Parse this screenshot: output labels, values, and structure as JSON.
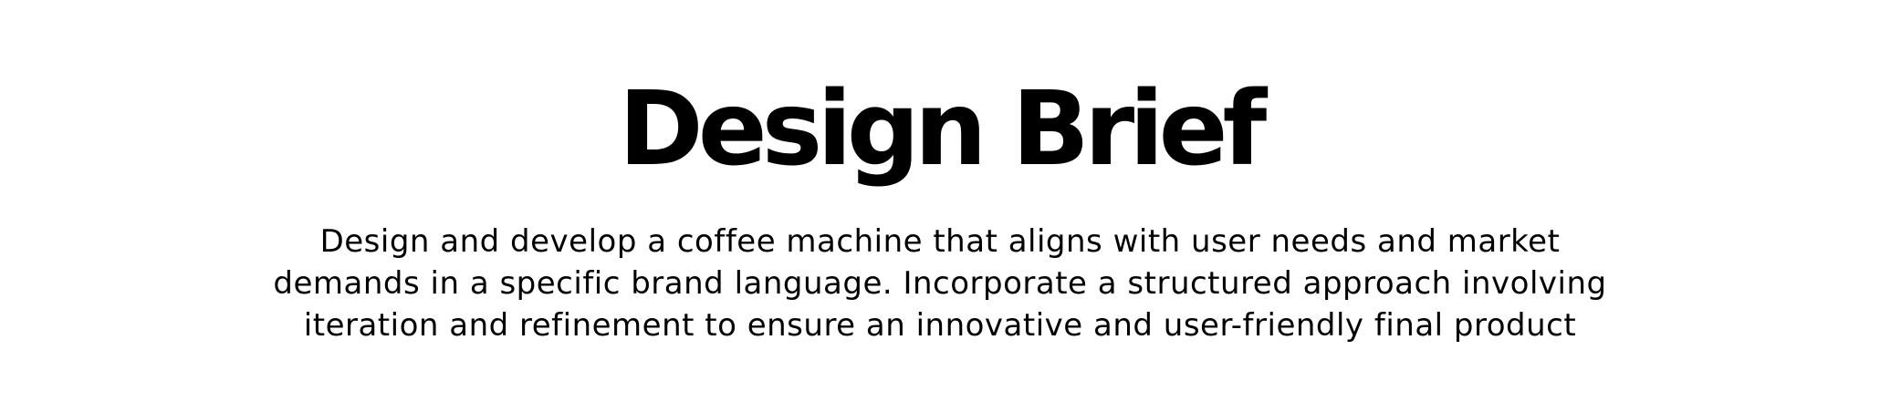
{
  "brief": {
    "title": "Design Brief",
    "description_lines": [
      "Design and develop a coffee machine that aligns with user needs and market",
      "demands in a specific brand language. Incorporate a structured approach involving",
      "iteration and refinement to ensure an innovative and user-friendly final product"
    ]
  }
}
